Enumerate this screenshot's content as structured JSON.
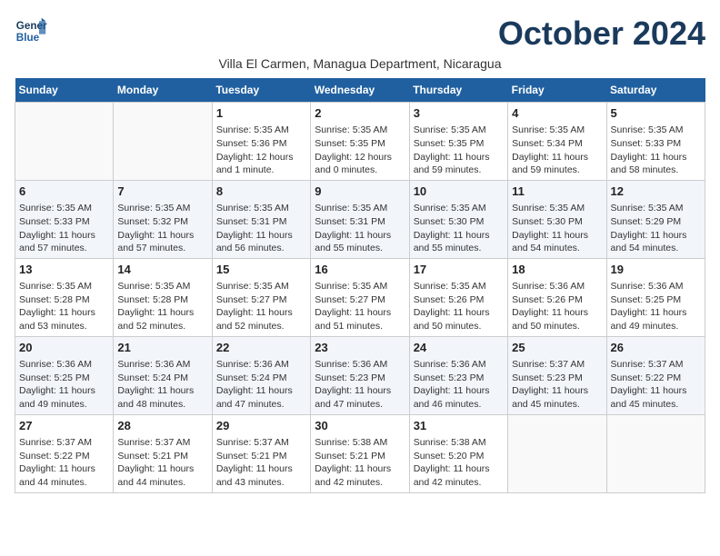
{
  "header": {
    "logo_line1": "General",
    "logo_line2": "Blue",
    "month_title": "October 2024",
    "subtitle": "Villa El Carmen, Managua Department, Nicaragua"
  },
  "weekdays": [
    "Sunday",
    "Monday",
    "Tuesday",
    "Wednesday",
    "Thursday",
    "Friday",
    "Saturday"
  ],
  "weeks": [
    [
      {
        "day": "",
        "info": ""
      },
      {
        "day": "",
        "info": ""
      },
      {
        "day": "1",
        "info": "Sunrise: 5:35 AM\nSunset: 5:36 PM\nDaylight: 12 hours\nand 1 minute."
      },
      {
        "day": "2",
        "info": "Sunrise: 5:35 AM\nSunset: 5:35 PM\nDaylight: 12 hours\nand 0 minutes."
      },
      {
        "day": "3",
        "info": "Sunrise: 5:35 AM\nSunset: 5:35 PM\nDaylight: 11 hours\nand 59 minutes."
      },
      {
        "day": "4",
        "info": "Sunrise: 5:35 AM\nSunset: 5:34 PM\nDaylight: 11 hours\nand 59 minutes."
      },
      {
        "day": "5",
        "info": "Sunrise: 5:35 AM\nSunset: 5:33 PM\nDaylight: 11 hours\nand 58 minutes."
      }
    ],
    [
      {
        "day": "6",
        "info": "Sunrise: 5:35 AM\nSunset: 5:33 PM\nDaylight: 11 hours\nand 57 minutes."
      },
      {
        "day": "7",
        "info": "Sunrise: 5:35 AM\nSunset: 5:32 PM\nDaylight: 11 hours\nand 57 minutes."
      },
      {
        "day": "8",
        "info": "Sunrise: 5:35 AM\nSunset: 5:31 PM\nDaylight: 11 hours\nand 56 minutes."
      },
      {
        "day": "9",
        "info": "Sunrise: 5:35 AM\nSunset: 5:31 PM\nDaylight: 11 hours\nand 55 minutes."
      },
      {
        "day": "10",
        "info": "Sunrise: 5:35 AM\nSunset: 5:30 PM\nDaylight: 11 hours\nand 55 minutes."
      },
      {
        "day": "11",
        "info": "Sunrise: 5:35 AM\nSunset: 5:30 PM\nDaylight: 11 hours\nand 54 minutes."
      },
      {
        "day": "12",
        "info": "Sunrise: 5:35 AM\nSunset: 5:29 PM\nDaylight: 11 hours\nand 54 minutes."
      }
    ],
    [
      {
        "day": "13",
        "info": "Sunrise: 5:35 AM\nSunset: 5:28 PM\nDaylight: 11 hours\nand 53 minutes."
      },
      {
        "day": "14",
        "info": "Sunrise: 5:35 AM\nSunset: 5:28 PM\nDaylight: 11 hours\nand 52 minutes."
      },
      {
        "day": "15",
        "info": "Sunrise: 5:35 AM\nSunset: 5:27 PM\nDaylight: 11 hours\nand 52 minutes."
      },
      {
        "day": "16",
        "info": "Sunrise: 5:35 AM\nSunset: 5:27 PM\nDaylight: 11 hours\nand 51 minutes."
      },
      {
        "day": "17",
        "info": "Sunrise: 5:35 AM\nSunset: 5:26 PM\nDaylight: 11 hours\nand 50 minutes."
      },
      {
        "day": "18",
        "info": "Sunrise: 5:36 AM\nSunset: 5:26 PM\nDaylight: 11 hours\nand 50 minutes."
      },
      {
        "day": "19",
        "info": "Sunrise: 5:36 AM\nSunset: 5:25 PM\nDaylight: 11 hours\nand 49 minutes."
      }
    ],
    [
      {
        "day": "20",
        "info": "Sunrise: 5:36 AM\nSunset: 5:25 PM\nDaylight: 11 hours\nand 49 minutes."
      },
      {
        "day": "21",
        "info": "Sunrise: 5:36 AM\nSunset: 5:24 PM\nDaylight: 11 hours\nand 48 minutes."
      },
      {
        "day": "22",
        "info": "Sunrise: 5:36 AM\nSunset: 5:24 PM\nDaylight: 11 hours\nand 47 minutes."
      },
      {
        "day": "23",
        "info": "Sunrise: 5:36 AM\nSunset: 5:23 PM\nDaylight: 11 hours\nand 47 minutes."
      },
      {
        "day": "24",
        "info": "Sunrise: 5:36 AM\nSunset: 5:23 PM\nDaylight: 11 hours\nand 46 minutes."
      },
      {
        "day": "25",
        "info": "Sunrise: 5:37 AM\nSunset: 5:23 PM\nDaylight: 11 hours\nand 45 minutes."
      },
      {
        "day": "26",
        "info": "Sunrise: 5:37 AM\nSunset: 5:22 PM\nDaylight: 11 hours\nand 45 minutes."
      }
    ],
    [
      {
        "day": "27",
        "info": "Sunrise: 5:37 AM\nSunset: 5:22 PM\nDaylight: 11 hours\nand 44 minutes."
      },
      {
        "day": "28",
        "info": "Sunrise: 5:37 AM\nSunset: 5:21 PM\nDaylight: 11 hours\nand 44 minutes."
      },
      {
        "day": "29",
        "info": "Sunrise: 5:37 AM\nSunset: 5:21 PM\nDaylight: 11 hours\nand 43 minutes."
      },
      {
        "day": "30",
        "info": "Sunrise: 5:38 AM\nSunset: 5:21 PM\nDaylight: 11 hours\nand 42 minutes."
      },
      {
        "day": "31",
        "info": "Sunrise: 5:38 AM\nSunset: 5:20 PM\nDaylight: 11 hours\nand 42 minutes."
      },
      {
        "day": "",
        "info": ""
      },
      {
        "day": "",
        "info": ""
      }
    ]
  ]
}
